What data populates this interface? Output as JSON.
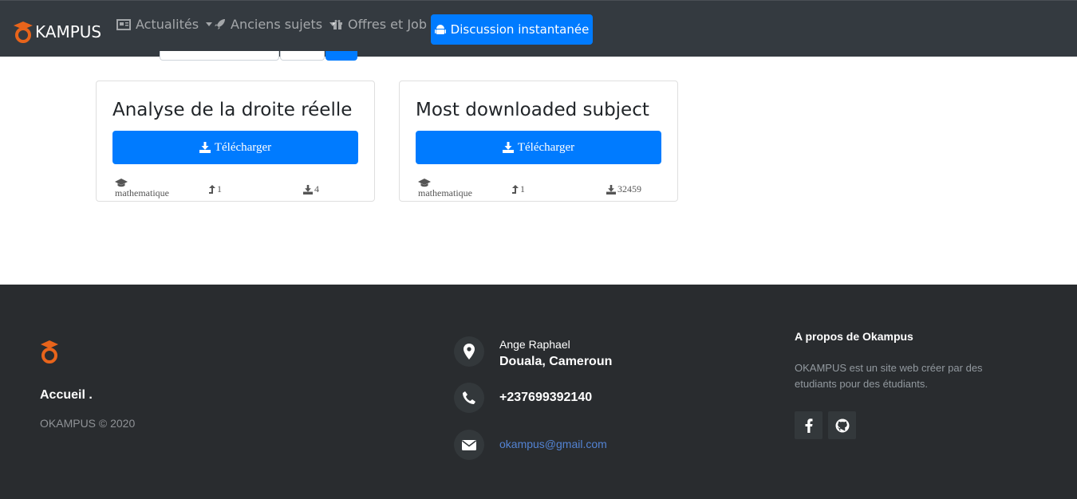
{
  "navbar": {
    "brand": "KAMPUS",
    "items": [
      {
        "label": "Actualités",
        "dropdown": true,
        "icon": "newspaper-icon"
      },
      {
        "label": "Anciens sujets",
        "dropdown": true,
        "icon": "rocket-icon"
      },
      {
        "label": "Offres et Job",
        "dropdown": false,
        "icon": "gift-icon"
      }
    ],
    "chat_button": "Discussion instantanée"
  },
  "cards": [
    {
      "title": "Analyse de la droite réelle",
      "download_label": "Télécharger",
      "category": "mathematique",
      "level": "1",
      "downloads": "4"
    },
    {
      "title": "Most downloaded subject",
      "download_label": "Télécharger",
      "category": "mathematique",
      "level": "1",
      "downloads": "32459"
    }
  ],
  "footer": {
    "accueil": "Accueil .",
    "copyright": "OKAMPUS © 2020",
    "contact": {
      "name": "Ange Raphael",
      "city": "Douala, Cameroun",
      "phone": "+237699392140",
      "email": "okampus@gmail.com"
    },
    "about": {
      "title": "A propos de Okampus",
      "text": "OKAMPUS est un site web créer par des etudiants pour des étudiants."
    }
  },
  "colors": {
    "primary": "#007bff",
    "navbar": "#343a40",
    "footer": "#292c2f",
    "brand_orange": "#e8641b"
  }
}
